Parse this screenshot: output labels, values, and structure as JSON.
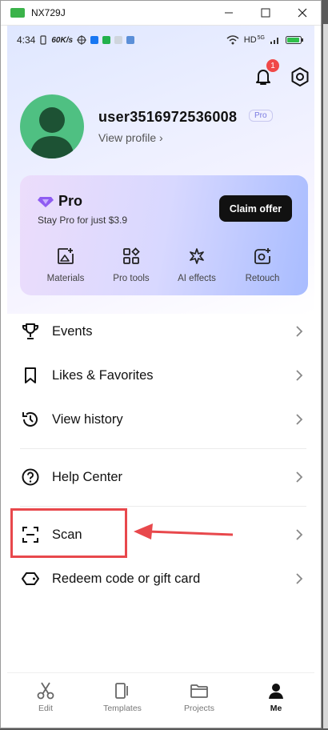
{
  "window": {
    "title": "NX729J",
    "minimize": "—",
    "maximize": "☐",
    "close": "✕"
  },
  "status_bar": {
    "time": "4:34",
    "speed": "60K/s",
    "network": "HD",
    "network_sub": "5G"
  },
  "header": {
    "notification_count": "1"
  },
  "profile": {
    "username": "user3516972536008",
    "tier_badge": "Pro",
    "view_profile": "View profile ›"
  },
  "pro_card": {
    "title": "Pro",
    "subtitle": "Stay Pro for just $3.9",
    "cta": "Claim offer",
    "features": [
      {
        "label": "Materials",
        "icon": "image-plus-icon"
      },
      {
        "label": "Pro tools",
        "icon": "grid-tools-icon"
      },
      {
        "label": "AI effects",
        "icon": "sparkle-icon"
      },
      {
        "label": "Retouch",
        "icon": "retouch-icon"
      }
    ]
  },
  "menu": {
    "events": "Events",
    "likes": "Likes & Favorites",
    "history": "View history",
    "help": "Help Center",
    "scan": "Scan",
    "redeem": "Redeem code or gift card"
  },
  "tabs": [
    {
      "label": "Edit",
      "icon": "scissors-icon"
    },
    {
      "label": "Templates",
      "icon": "templates-icon"
    },
    {
      "label": "Projects",
      "icon": "folder-icon"
    },
    {
      "label": "Me",
      "icon": "person-icon",
      "active": true
    }
  ],
  "colors": {
    "accent_red": "#e8484c",
    "avatar_green": "#4fc082",
    "cta_black": "#111111"
  }
}
